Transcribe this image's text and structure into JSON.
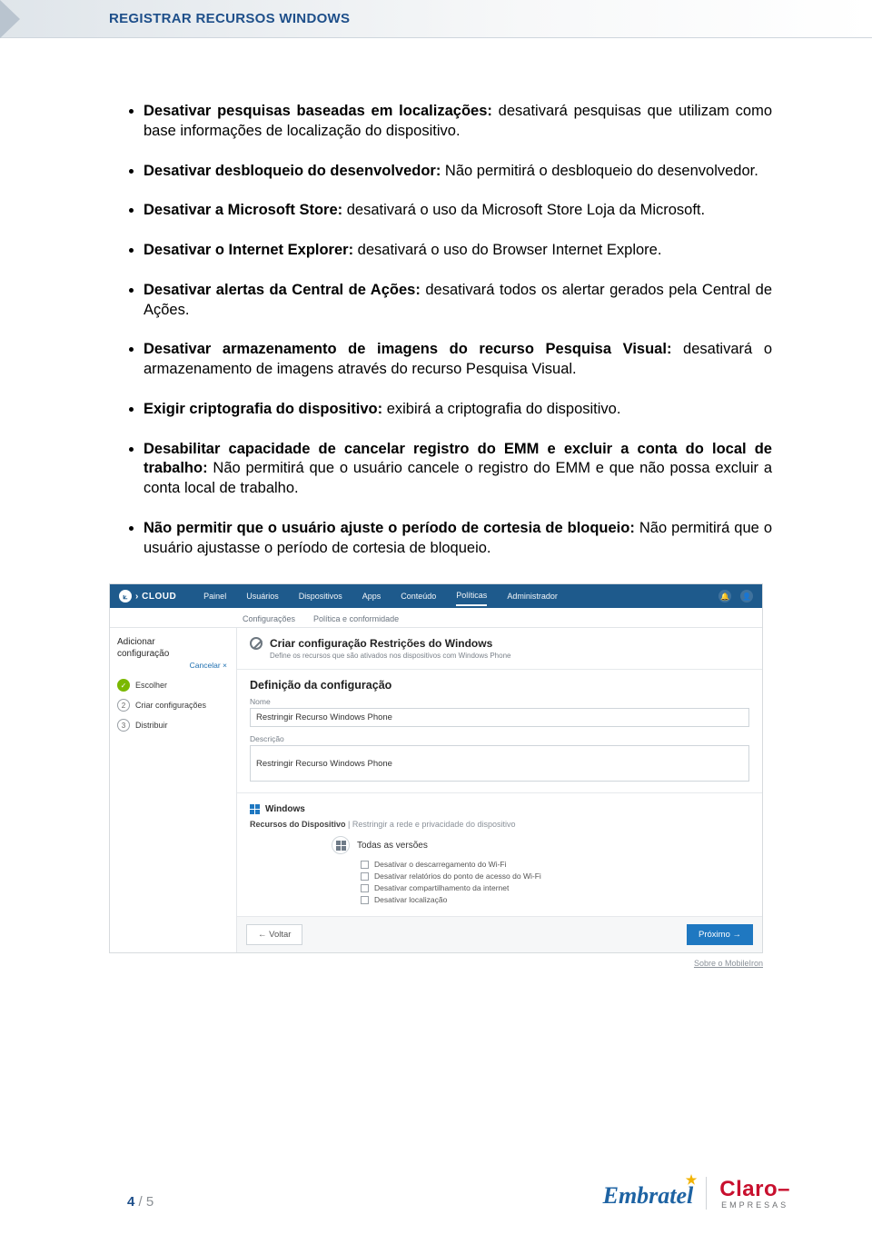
{
  "header": {
    "title": "REGISTRAR RECURSOS WINDOWS"
  },
  "bullets": [
    {
      "bold": "Desativar pesquisas baseadas em localizações:",
      "text": " desativará pesquisas que utilizam como base informações de localização do dispositivo."
    },
    {
      "bold": "Desativar desbloqueio do desenvolvedor:",
      "text": " Não permitirá o desbloqueio do desenvolvedor."
    },
    {
      "bold": "Desativar a Microsoft Store:",
      "text": " desativará o uso da Microsoft Store Loja da Microsoft."
    },
    {
      "bold": "Desativar o Internet Explorer:",
      "text": " desativará o uso do Browser Internet Explore."
    },
    {
      "bold": "Desativar alertas da Central de Ações:",
      "text": " desativará todos os alertar gerados pela Central de Ações."
    },
    {
      "bold": "Desativar armazenamento de imagens do recurso Pesquisa Visual:",
      "text": " desativará o armazenamento de imagens através do recurso Pesquisa Visual."
    },
    {
      "bold": "Exigir criptografia do dispositivo:",
      "text": " exibirá a criptografia do dispositivo."
    },
    {
      "bold": "Desabilitar capacidade de cancelar registro do EMM e excluir a conta do local de trabalho:",
      "text": " Não permitirá que o usuário cancele o registro do EMM e que não possa excluir a conta local de trabalho."
    },
    {
      "bold": "Não permitir que o usuário ajuste o período de cortesia de bloqueio:",
      "text": " Não permitirá que o usuário ajustasse o período de cortesia de bloqueio."
    }
  ],
  "mock": {
    "brand": "› CLOUD",
    "topnav": [
      "Painel",
      "Usuários",
      "Dispositivos",
      "Apps",
      "Conteúdo",
      "Políticas",
      "Administrador"
    ],
    "topnav_active": "Políticas",
    "subnav": [
      "Configurações",
      "Política e conformidade"
    ],
    "side": {
      "title": "Adicionar",
      "sub": "configuração",
      "cancel": "Cancelar ×",
      "steps": [
        {
          "label": "Escolher",
          "done": true,
          "num": "✓"
        },
        {
          "label": "Criar configurações",
          "done": false,
          "num": "2"
        },
        {
          "label": "Distribuir",
          "done": false,
          "num": "3"
        }
      ]
    },
    "panel": {
      "title": "Criar configuração Restrições do Windows",
      "sub": "Define os recursos que são ativados nos dispositivos com Windows Phone"
    },
    "form": {
      "section": "Definição da configuração",
      "name_label": "Nome",
      "name_value": "Restringir Recurso Windows Phone",
      "desc_label": "Descrição",
      "desc_value": "Restringir Recurso Windows Phone",
      "win_label": "Windows",
      "group_bold": "Recursos do Dispositivo",
      "group_muted": " | Restringir a rede e privacidade do dispositivo",
      "options_title": "Todas as versões",
      "options": [
        "Desativar o descarregamento do Wi-Fi",
        "Desativar relatórios do ponto de acesso do Wi-Fi",
        "Desativar compartilhamento da internet",
        "Desativar localização"
      ]
    },
    "footer": {
      "back": "← Voltar",
      "next": "Próximo →"
    },
    "below_link": "Sobre o MobileIron"
  },
  "pagefoot": {
    "cur": "4",
    "sep": " / ",
    "tot": "5",
    "embratel": "Embratel",
    "claro": "Claro",
    "claro_sub": "EMPRESAS"
  }
}
